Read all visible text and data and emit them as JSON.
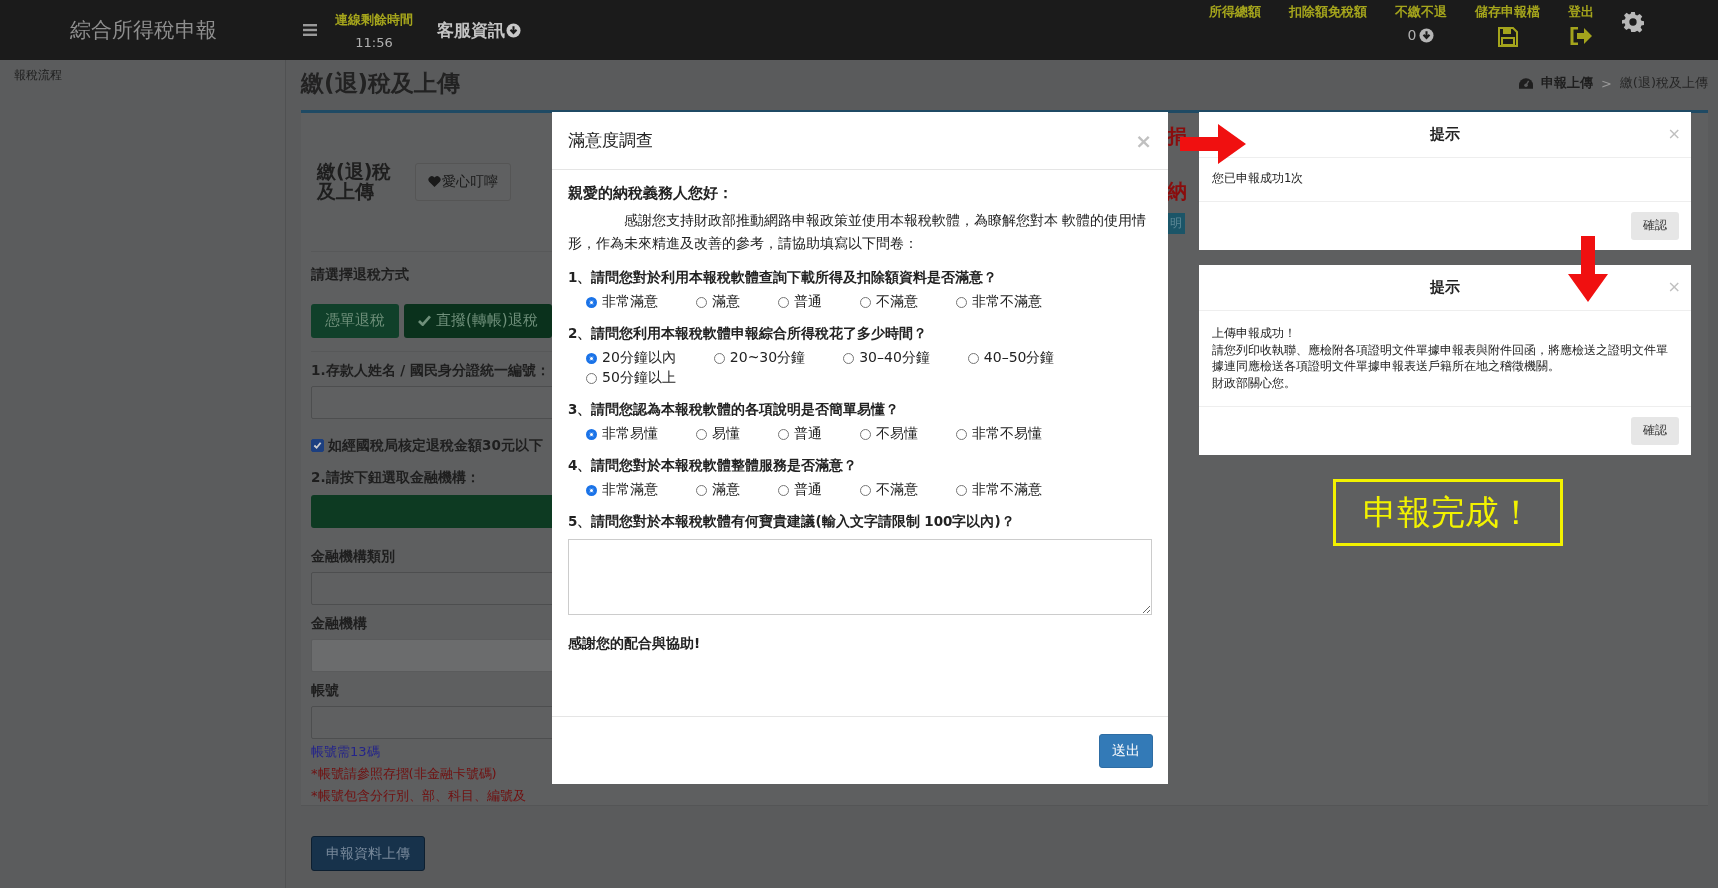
{
  "header": {
    "logo": "綜合所得稅申報",
    "session_label": "連線剩餘時間",
    "session_time": "11:56",
    "service": "客服資訊",
    "items": [
      {
        "kind": "text",
        "label": "所得總額"
      },
      {
        "kind": "text",
        "label": "扣除額免稅額"
      },
      {
        "kind": "value",
        "label": "不繳不退",
        "value": "0"
      },
      {
        "kind": "save",
        "label": "儲存申報檔"
      },
      {
        "kind": "logout",
        "label": "登出"
      }
    ]
  },
  "sidebar": {
    "items": [
      "報稅流程"
    ]
  },
  "page": {
    "title": "繳(退)稅及上傳",
    "breadcrumb": [
      "申報上傳",
      "繳(退)稅及上傳"
    ],
    "breadcrumb_separator": ">"
  },
  "panel": {
    "heading": "繳(退)稅及上傳",
    "reminder_button": "愛心叮嚀",
    "refund_label": "請選擇退稅方式",
    "refund_methods": [
      {
        "label": "憑單退稅",
        "selected": false
      },
      {
        "label": "直撥(轉帳)退稅",
        "selected": true
      }
    ],
    "form": [
      {
        "kind": "label",
        "text": "1.存款人姓名 / 國民身分證統一編號："
      },
      {
        "kind": "input",
        "disabled": false
      },
      {
        "kind": "checkbox",
        "text": "如經國稅局核定退稅金額30元以下",
        "checked": true
      },
      {
        "kind": "label",
        "text": "2.請按下鈕選取金融機構："
      },
      {
        "kind": "bar"
      },
      {
        "kind": "label",
        "text": "金融機構類別"
      },
      {
        "kind": "input",
        "disabled": false
      },
      {
        "kind": "label",
        "text": "金融機構"
      },
      {
        "kind": "input",
        "disabled": true
      },
      {
        "kind": "label",
        "text": "帳號"
      },
      {
        "kind": "input",
        "disabled": false
      },
      {
        "kind": "hint",
        "text": "帳號需13碼"
      },
      {
        "kind": "warning",
        "text": "*帳號請參照存摺(非金融卡號碼)"
      },
      {
        "kind": "warning",
        "text": "*帳號包含分行別、部、科目、編號及"
      }
    ],
    "fragments": [
      {
        "kind": "alert",
        "text": "捐"
      },
      {
        "kind": "alert",
        "text": "納"
      },
      {
        "kind": "tag",
        "text": "明"
      }
    ],
    "upload_button": "申報資料上傳"
  },
  "survey": {
    "title": "滿意度調查",
    "close": "×",
    "greeting": "親愛的納稅義務人您好：",
    "intro": "感謝您支持財政部推動網路申報政策並使用本報稅軟體，為瞭解您對本 軟體的使用情形，作為未來精進及改善的參考，請協助填寫以下問卷：",
    "questions": [
      {
        "text": "1、請問您對於利用本報稅軟體查詢下載所得及扣除額資料是否滿意？",
        "options": [
          {
            "label": "非常滿意",
            "selected": true
          },
          {
            "label": "滿意",
            "selected": false
          },
          {
            "label": "普通",
            "selected": false
          },
          {
            "label": "不滿意",
            "selected": false
          },
          {
            "label": "非常不滿意",
            "selected": false
          }
        ]
      },
      {
        "text": "2、請問您利用本報稅軟體申報綜合所得稅花了多少時間？",
        "options": [
          {
            "label": "20分鐘以內",
            "selected": true
          },
          {
            "label": "20~30分鐘",
            "selected": false
          },
          {
            "label": "30–40分鐘",
            "selected": false
          },
          {
            "label": "40–50分鐘",
            "selected": false
          },
          {
            "label": "50分鐘以上",
            "selected": false
          }
        ]
      },
      {
        "text": "3、請問您認為本報稅軟體的各項說明是否簡單易懂？",
        "options": [
          {
            "label": "非常易懂",
            "selected": true
          },
          {
            "label": "易懂",
            "selected": false
          },
          {
            "label": "普通",
            "selected": false
          },
          {
            "label": "不易懂",
            "selected": false
          },
          {
            "label": "非常不易懂",
            "selected": false
          }
        ]
      },
      {
        "text": "4、請問您對於本報稅軟體整體服務是否滿意？",
        "options": [
          {
            "label": "非常滿意",
            "selected": true
          },
          {
            "label": "滿意",
            "selected": false
          },
          {
            "label": "普通",
            "selected": false
          },
          {
            "label": "不滿意",
            "selected": false
          },
          {
            "label": "非常不滿意",
            "selected": false
          }
        ]
      }
    ],
    "comment_question": "5、請問您對於本報稅軟體有何寶貴建議(輸入文字請限制 100字以內)？",
    "thanks": "感謝您的配合與協助!",
    "submit": "送出"
  },
  "dialogs": [
    {
      "title": "提示",
      "close": "×",
      "lines": [
        "您已申報成功1次"
      ],
      "button": "確認"
    },
    {
      "title": "提示",
      "close": "×",
      "lines": [
        "上傳申報成功！",
        "請您列印收執聯、應檢附各項證明文件單據申報表與附件回函，將應檢送之證明文件單據連同應檢送各項證明文件單據申報表送戶籍所在地之稽徵機關。",
        "財政部關心您。"
      ],
      "button": "確認"
    }
  ],
  "annotations": [
    {
      "kind": "arrow_right"
    },
    {
      "kind": "arrow_down"
    }
  ],
  "callout": "申報完成！"
}
